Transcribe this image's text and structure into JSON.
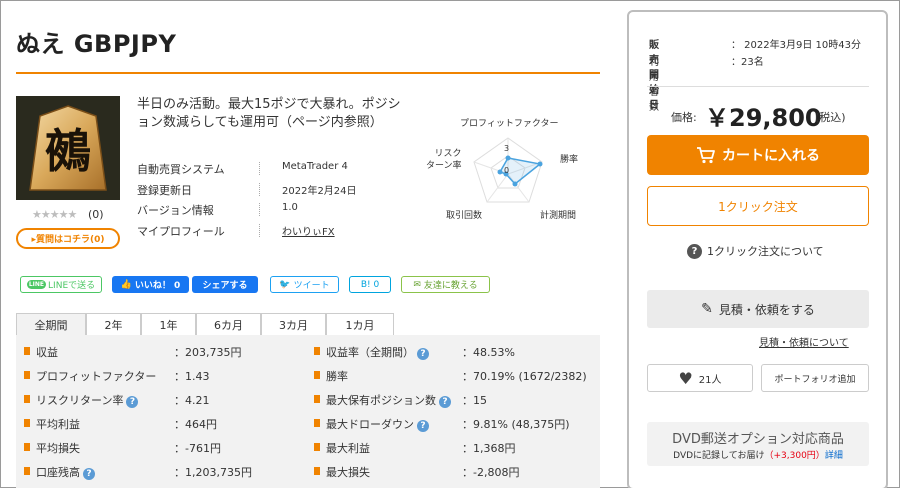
{
  "product": {
    "title": "ぬえ GBPJPY",
    "logo_char": "鵺",
    "rating_stars": "★★★★★",
    "rating_count": "(0)",
    "question_button": "▸質問はコチラ(0)",
    "description": "半日のみ活動。最大15ポジで大暴れ。ポジション数減らしても運用可（ページ内参照）",
    "info": [
      {
        "label": "自動売買システム",
        "value": "MetaTrader 4"
      },
      {
        "label": "登録更新日",
        "value": "2022年2月24日"
      },
      {
        "label": "バージョン情報",
        "value": "1.0"
      },
      {
        "label": "マイプロフィール",
        "value": "わいりぃFX"
      }
    ]
  },
  "radar": {
    "labels": {
      "top": "プロフィットファクター",
      "right": "勝率",
      "bottom_right": "計測期間",
      "bottom_left": "取引回数",
      "left": "リスク\nターン率"
    },
    "scale_label_3": "3",
    "scale_label_0": "0",
    "line_color": "#4aa3df"
  },
  "share": {
    "line": "LINEで送る",
    "line_badge": "LINE",
    "like": "いいね！ 0",
    "share": "シェアする",
    "tweet": "ツイート",
    "hatena": "B! 0",
    "friend": "友達に教える"
  },
  "tabs": [
    "全期間",
    "2年",
    "1年",
    "6カ月",
    "3カ月",
    "1カ月"
  ],
  "stats_left": [
    {
      "label": "収益",
      "value": "：203,735円",
      "help": false
    },
    {
      "label": "プロフィットファクター",
      "value": "：1.43",
      "help": false
    },
    {
      "label": "リスクリターン率",
      "value": "：4.21",
      "help": true
    },
    {
      "label": "平均利益",
      "value": "：464円",
      "help": false
    },
    {
      "label": "平均損失",
      "value": "：-761円",
      "help": false
    },
    {
      "label": "口座残高",
      "value": "：1,203,735円",
      "help": true
    }
  ],
  "stats_right": [
    {
      "label": "収益率（全期間）",
      "value": "：48.53%",
      "help": true
    },
    {
      "label": "勝率",
      "value": "：70.19% (1672/2382)",
      "help": false
    },
    {
      "label": "最大保有ポジション数",
      "value": "：15",
      "help": true
    },
    {
      "label": "最大ドローダウン",
      "value": "：9.81% (48,375円)",
      "help": true
    },
    {
      "label": "最大利益",
      "value": "：1,368円",
      "help": false
    },
    {
      "label": "最大損失",
      "value": "：-2,808円",
      "help": false
    }
  ],
  "sidebar": {
    "release_label": "販売開始日",
    "release_value": "：  2022年3月9日 10時43分",
    "users_label": "利用者数",
    "users_value": "：23名",
    "price_label": "価格:",
    "price_value": "￥29,800",
    "price_tax": "(税込)",
    "cart_button": "カートに入れる",
    "oneclick_button": "1クリック注文",
    "about_oneclick": "1クリック注文について",
    "estimate_button": "見積・依頼をする",
    "estimate_link": "見積・依頼について",
    "fav_count": "21人",
    "portfolio_button": "ポートフォリオ追加",
    "dvd_title": "DVD郵送オプション対応商品",
    "dvd_sub_a": "DVDに記録してお届け",
    "dvd_sub_price": "（+3,300円）",
    "dvd_sub_detail": "詳細",
    "accent_color": "#f08300"
  }
}
